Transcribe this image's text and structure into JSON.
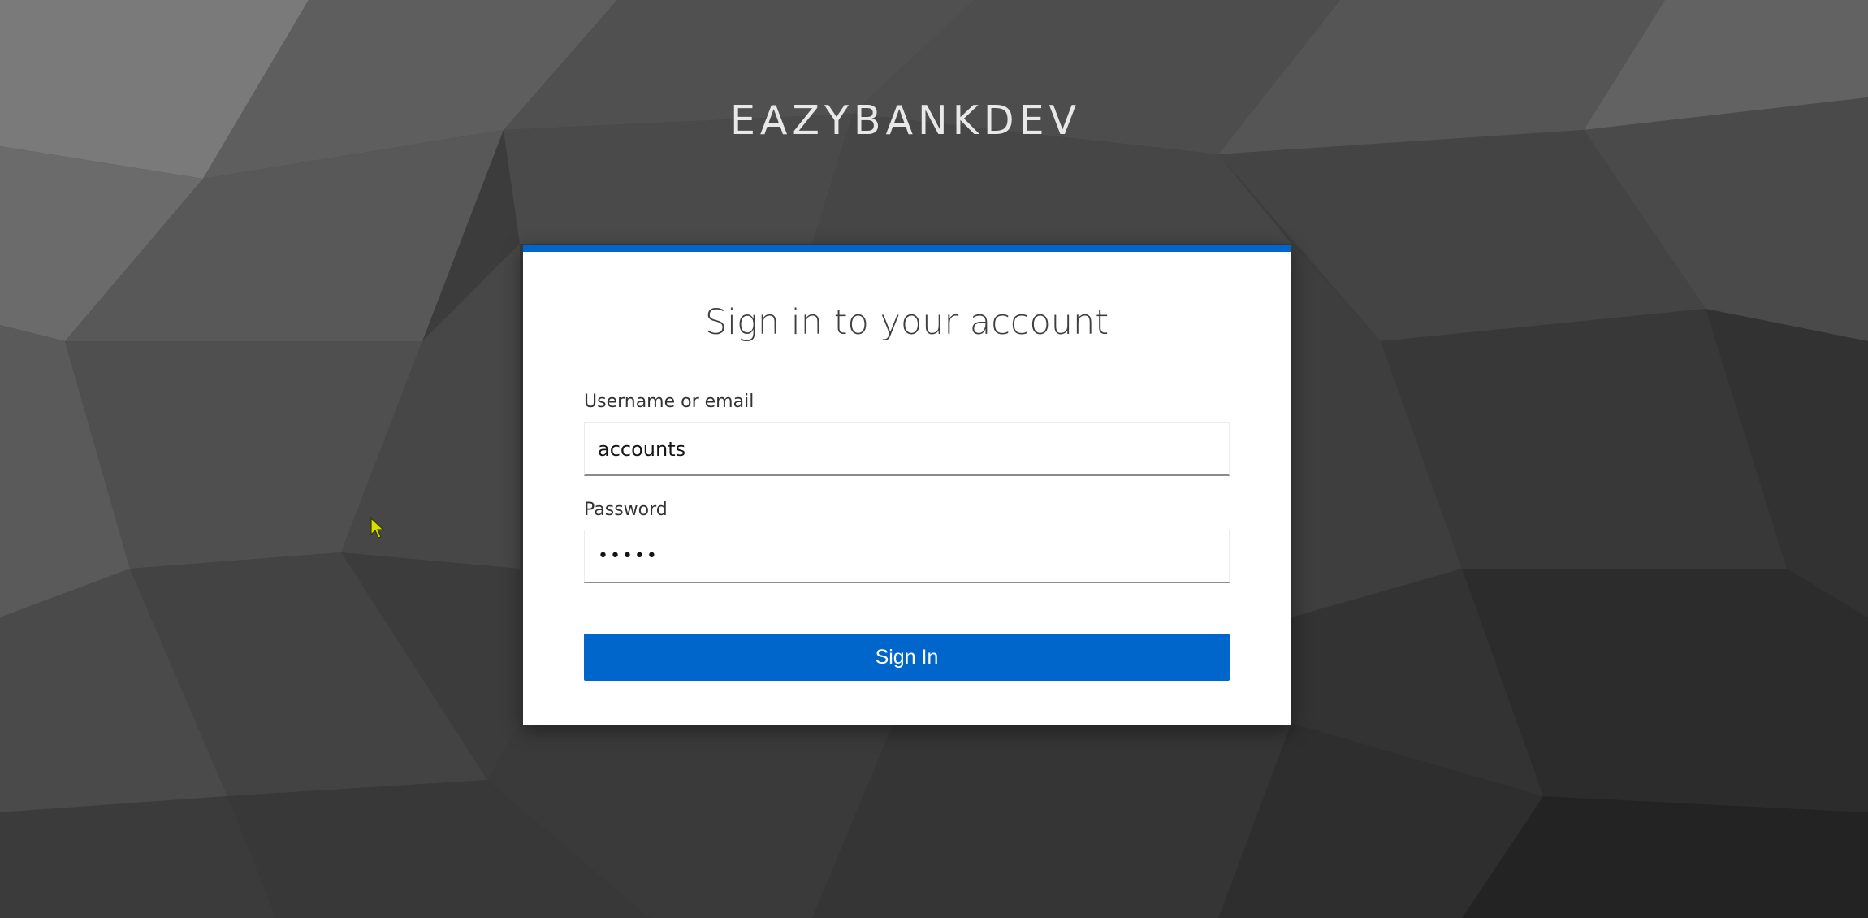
{
  "realm": {
    "title": "EAZYBANKDEV"
  },
  "login_form": {
    "heading": "Sign in to your account",
    "username": {
      "label": "Username or email",
      "value": "accounts"
    },
    "password": {
      "label": "Password",
      "value": "•••••"
    },
    "submit_label": "Sign In"
  },
  "colors": {
    "accent": "#0066cc",
    "background": "#3a3a3a",
    "card": "#ffffff",
    "cursor": "#d4e000"
  }
}
